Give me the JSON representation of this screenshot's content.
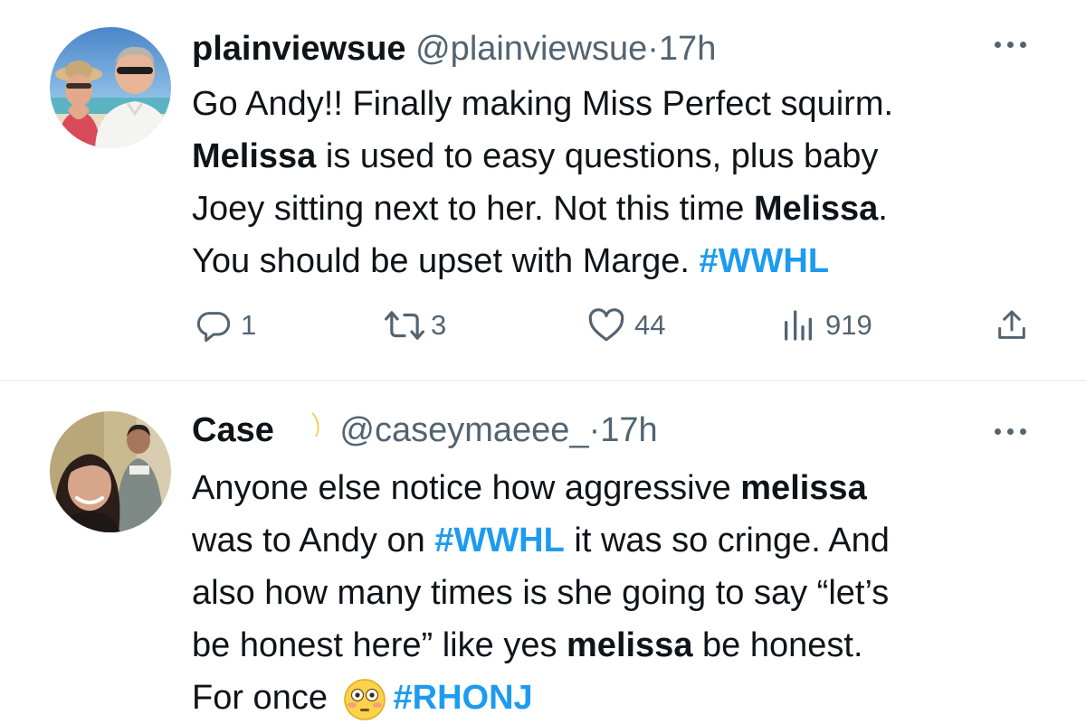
{
  "tweets": [
    {
      "name": "plainviewsue",
      "handle": "@plainviewsue",
      "dot": "·",
      "time": "17h",
      "lines": [
        {
          "a": "Go Andy!!  Finally making Miss Perfect squirm."
        },
        {
          "b1": "Melissa",
          "a": " is used to easy questions, plus baby"
        },
        {
          "a": "Joey sitting next to her. Not this time ",
          "b1": "Melissa",
          "c": "."
        },
        {
          "a": "You should be upset with Marge. ",
          "tag": "#WWHL"
        }
      ],
      "stats": {
        "replies": "1",
        "retweets": "3",
        "likes": "44",
        "views": "919"
      }
    },
    {
      "name": "Case",
      "name_emoji": "crescent-moon",
      "handle": "@caseymaeee_",
      "dot": "·",
      "time": "17h",
      "lines": [
        {
          "a": "Anyone else notice how aggressive ",
          "b1": "melissa"
        },
        {
          "a": "was to Andy on ",
          "tag": "#WWHL",
          "c": " it was so cringe. And"
        },
        {
          "a": "also how many times is she going to say “let’s"
        },
        {
          "a": "be honest here” like yes ",
          "b1": "melissa",
          "c": " be honest."
        },
        {
          "a": "For once ",
          "emoji": "flushed-face",
          "tag": "#RHONJ"
        }
      ]
    }
  ],
  "colors": {
    "text": "#0f1419",
    "secondary": "#536471",
    "link": "#1d9bf0",
    "divider": "#eff3f4"
  },
  "icons": {
    "reply": "reply-icon",
    "retweet": "retweet-icon",
    "like": "like-icon",
    "views": "views-icon",
    "share": "share-icon",
    "more": "more-icon"
  }
}
